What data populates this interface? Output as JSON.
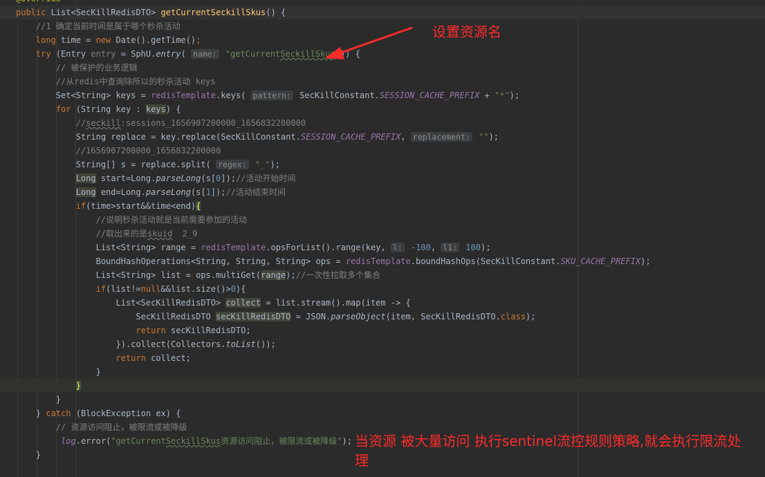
{
  "editor": {
    "background": "#2b2b2b",
    "lines": [
      {
        "segs": [
          {
            "t": "@Override",
            "c": "ann"
          }
        ]
      },
      {
        "segs": [
          {
            "t": "public ",
            "c": "kw"
          },
          {
            "t": "List<SecKillRedisDTO> "
          },
          {
            "t": "getCurrentSeckillSkus",
            "c": "mth"
          },
          {
            "t": "() {"
          }
        ]
      },
      {
        "segs": [
          {
            "t": "    //1 确定当前时间是属于哪个秒杀活动",
            "c": "cmt"
          }
        ]
      },
      {
        "segs": [
          {
            "t": "    "
          },
          {
            "t": "long ",
            "c": "kw"
          },
          {
            "t": "time = "
          },
          {
            "t": "new ",
            "c": "kw"
          },
          {
            "t": "Date().getTime()"
          },
          {
            "t": ";",
            "c": "kw"
          }
        ]
      },
      {
        "segs": [
          {
            "t": "    "
          },
          {
            "t": "try ",
            "c": "kw"
          },
          {
            "t": "(Entry "
          },
          {
            "t": "entry",
            "c": "cmt"
          },
          {
            "t": " = SphU."
          },
          {
            "t": "entry",
            "c": "it"
          },
          {
            "t": "( "
          },
          {
            "t": "name:",
            "c": "hint"
          },
          {
            "t": " \"getCurrent",
            "c": "str"
          },
          {
            "t": "Seckill",
            "c": "str und"
          },
          {
            "t": "Skus",
            "c": "str und"
          },
          {
            "t": "\"",
            "c": "str"
          },
          {
            "t": ")) {"
          }
        ]
      },
      {
        "segs": [
          {
            "t": "        // 被保护的业务逻辑",
            "c": "cmt"
          }
        ]
      },
      {
        "segs": [
          {
            "t": "        //从redis中查询除所以的秒杀活动 keys",
            "c": "cmt"
          }
        ]
      },
      {
        "segs": [
          {
            "t": "        Set<String> keys = "
          },
          {
            "t": "redisTemplate",
            "c": "ifld"
          },
          {
            "t": ".keys( "
          },
          {
            "t": "pattern:",
            "c": "hint"
          },
          {
            "t": " SecKillConstant."
          },
          {
            "t": "SESSION_CACHE_PREFIX",
            "c": "fld"
          },
          {
            "t": " + "
          },
          {
            "t": "\"*\"",
            "c": "str"
          },
          {
            "t": ");"
          }
        ]
      },
      {
        "segs": [
          {
            "t": "        "
          },
          {
            "t": "for ",
            "c": "kw"
          },
          {
            "t": "(String key : "
          },
          {
            "t": "keys",
            "c": "var"
          },
          {
            "t": ") {"
          }
        ]
      },
      {
        "segs": [
          {
            "t": "            //",
            "c": "cmt"
          },
          {
            "t": "seckill",
            "c": "cmt und2"
          },
          {
            "t": ":sessions_1656907200000_1656832200000",
            "c": "cmt"
          }
        ]
      },
      {
        "segs": [
          {
            "t": "            String replace = key.replace(SecKillConstant."
          },
          {
            "t": "SESSION_CACHE_PREFIX",
            "c": "fld"
          },
          {
            "t": ", "
          },
          {
            "t": "replacement:",
            "c": "hint"
          },
          {
            "t": " \"\"",
            "c": "str"
          },
          {
            "t": ");"
          }
        ]
      },
      {
        "segs": [
          {
            "t": "            //1656907200000_1656832200000",
            "c": "cmt"
          }
        ]
      },
      {
        "segs": [
          {
            "t": "            String[] s = replace.split( "
          },
          {
            "t": "regex:",
            "c": "hint"
          },
          {
            "t": " \"_\"",
            "c": "str"
          },
          {
            "t": ");"
          }
        ]
      },
      {
        "segs": [
          {
            "t": "            "
          },
          {
            "t": "Long",
            "c": "var"
          },
          {
            "t": " start=Long."
          },
          {
            "t": "parseLong",
            "c": "it"
          },
          {
            "t": "(s["
          },
          {
            "t": "0",
            "c": "num"
          },
          {
            "t": "]);"
          },
          {
            "t": "//活动开始时间",
            "c": "cmt"
          }
        ]
      },
      {
        "segs": [
          {
            "t": "            "
          },
          {
            "t": "Long",
            "c": "var"
          },
          {
            "t": " end=Long."
          },
          {
            "t": "parseLong",
            "c": "it"
          },
          {
            "t": "(s["
          },
          {
            "t": "1",
            "c": "num"
          },
          {
            "t": "]);"
          },
          {
            "t": "//活动结束时间",
            "c": "cmt"
          }
        ]
      },
      {
        "segs": [
          {
            "t": "            "
          },
          {
            "t": "if",
            "c": "kw"
          },
          {
            "t": "(time>start&&time<end)"
          },
          {
            "t": "{",
            "c": "brace"
          }
        ]
      },
      {
        "segs": [
          {
            "t": "                //说明秒杀活动就是当前需要参加的活动",
            "c": "cmt"
          }
        ]
      },
      {
        "segs": [
          {
            "t": "                //取出来的是",
            "c": "cmt"
          },
          {
            "t": "skuid",
            "c": "cmt und2"
          },
          {
            "t": "  2_9",
            "c": "cmt"
          }
        ]
      },
      {
        "segs": [
          {
            "t": "                List<String> range = "
          },
          {
            "t": "redisTemplate",
            "c": "ifld"
          },
          {
            "t": ".opsForList().range(key, "
          },
          {
            "t": "l:",
            "c": "hint"
          },
          {
            "t": " -100",
            "c": "num"
          },
          {
            "t": ", "
          },
          {
            "t": "l1:",
            "c": "hint"
          },
          {
            "t": " 100",
            "c": "num"
          },
          {
            "t": ");"
          }
        ]
      },
      {
        "segs": [
          {
            "t": "                BoundHashOperations<String, String, String> ops = "
          },
          {
            "t": "redisTemplate",
            "c": "ifld"
          },
          {
            "t": ".boundHashOps(SecKillConstant."
          },
          {
            "t": "SKU_CACHE_PREFIX",
            "c": "fld"
          },
          {
            "t": ");"
          }
        ]
      },
      {
        "segs": [
          {
            "t": "                List<String> list = ops.multiGet("
          },
          {
            "t": "range",
            "c": "var"
          },
          {
            "t": ");"
          },
          {
            "t": "//一次性拉取多个集合",
            "c": "cmt"
          }
        ]
      },
      {
        "segs": [
          {
            "t": "                "
          },
          {
            "t": "if",
            "c": "kw"
          },
          {
            "t": "(list!="
          },
          {
            "t": "null",
            "c": "kw"
          },
          {
            "t": "&&list.size()>"
          },
          {
            "t": "0",
            "c": "num"
          },
          {
            "t": "){"
          }
        ]
      },
      {
        "segs": [
          {
            "t": "                    List<SecKillRedisDTO> "
          },
          {
            "t": "collect",
            "c": "var"
          },
          {
            "t": " = list.stream().map(item -> {"
          }
        ]
      },
      {
        "segs": [
          {
            "t": "                        SecKillRedisDTO "
          },
          {
            "t": "secKillRedisDTO",
            "c": "var"
          },
          {
            "t": " = JSON."
          },
          {
            "t": "parseObject",
            "c": "it"
          },
          {
            "t": "(item, SecKillRedisDTO."
          },
          {
            "t": "class",
            "c": "kw"
          },
          {
            "t": ");"
          }
        ]
      },
      {
        "segs": [
          {
            "t": "                        "
          },
          {
            "t": "return ",
            "c": "kw"
          },
          {
            "t": "secKillRedisDTO;"
          }
        ]
      },
      {
        "segs": [
          {
            "t": "                    }).collect(Collectors."
          },
          {
            "t": "toList",
            "c": "it"
          },
          {
            "t": "());"
          }
        ]
      },
      {
        "segs": [
          {
            "t": "                    "
          },
          {
            "t": "return ",
            "c": "kw"
          },
          {
            "t": "collect;"
          }
        ]
      },
      {
        "segs": [
          {
            "t": "                }"
          }
        ]
      },
      {
        "segs": [
          {
            "t": "            "
          },
          {
            "t": "}",
            "c": "brace"
          }
        ],
        "cur": true
      },
      {
        "segs": [
          {
            "t": "        }"
          }
        ]
      },
      {
        "segs": [
          {
            "t": "    } "
          },
          {
            "t": "catch ",
            "c": "kw"
          },
          {
            "t": "(BlockException ex) {"
          }
        ]
      },
      {
        "segs": [
          {
            "t": "        // 资源访问阻止，被限流或被降级",
            "c": "cmt"
          }
        ]
      },
      {
        "segs": [
          {
            "t": "         "
          },
          {
            "t": "log",
            "c": "fld"
          },
          {
            "t": ".error("
          },
          {
            "t": "\"getCurrent",
            "c": "str"
          },
          {
            "t": "Seckill",
            "c": "str und"
          },
          {
            "t": "Skus",
            "c": "str und"
          },
          {
            "t": "资源访问阻止，被限流或被降级\"",
            "c": "str"
          },
          {
            "t": ");"
          }
        ]
      },
      {
        "segs": [
          {
            "t": "    }"
          }
        ]
      },
      {
        "segs": [
          {
            "t": ""
          }
        ]
      }
    ]
  },
  "annotations": {
    "top_label": "设置资源名",
    "bottom_label_line1": "当资源 被大量访问  执行sentinel流控规则策略,就会执行限流处",
    "bottom_label_line2": "理",
    "color": "#ff2a2a"
  }
}
